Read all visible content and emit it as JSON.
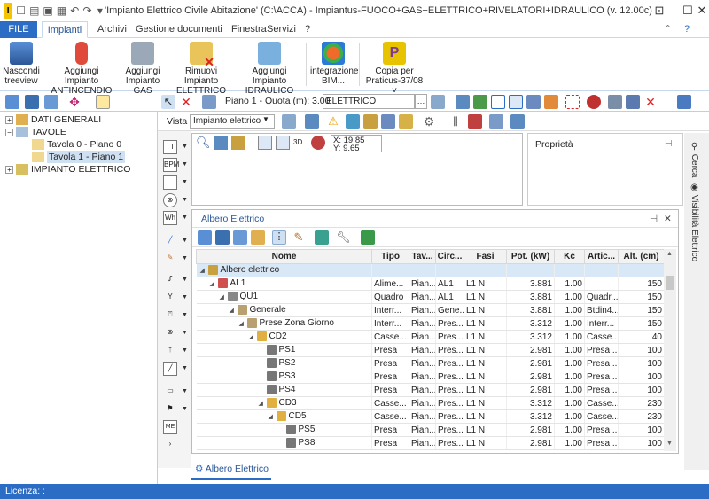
{
  "window": {
    "title": "'Impianto Elettrico Civile Abitazione' (C:\\ACCA) - Impiantus-FUOCO+GAS+ELETTRICO+RIVELATORI+IDRAULICO (v. 12.00c)"
  },
  "menu": {
    "file": "FILE",
    "tabs": [
      "Impianti",
      "Archivi",
      "Gestione documenti",
      "Finestra",
      "Servizi",
      "?"
    ]
  },
  "ribbon": [
    {
      "label": "Nascondi treeview"
    },
    {
      "label": "Aggiungi Impianto ANTINCENDIO"
    },
    {
      "label": "Aggiungi Impianto GAS"
    },
    {
      "label": "Rimuovi Impianto ELETTRICO"
    },
    {
      "label": "Aggiungi Impianto IDRAULICO"
    },
    {
      "label": "integrazione BIM..."
    },
    {
      "label": "Copia per Praticus-37/08 ˅"
    }
  ],
  "tree": [
    {
      "label": "DATI GENERALI",
      "expander": "+"
    },
    {
      "label": "TAVOLE",
      "expander": "−"
    },
    {
      "label": "Tavola 0 - Piano 0"
    },
    {
      "label": "Tavola 1 - Piano 1"
    },
    {
      "label": "IMPIANTO ELETTRICO",
      "expander": "+"
    }
  ],
  "toolbar": {
    "piano": "Piano 1 - Quota (m): 3.00",
    "layer": "ELETTRICO"
  },
  "vista": {
    "label": "Vista",
    "value": "Impianto elettrico"
  },
  "coords": {
    "x": "X: 19.85",
    "y": "Y: 9.65"
  },
  "props": {
    "title": "Proprietà",
    "pin": "⊣"
  },
  "side_tabs": [
    "Cerca",
    "Visibilità Elettrico"
  ],
  "albero": {
    "title": "Albero Elettrico",
    "pin": "⊣",
    "close": "✕",
    "bottom_tab": "Albero Elettrico",
    "columns": [
      "Nome",
      "Tipo",
      "Tav...",
      "Circ...",
      "Fasi",
      "Pot. (kW)",
      "Kc",
      "Artic...",
      "Alt. (cm)"
    ],
    "rows": [
      {
        "indent": 0,
        "expander": "◢",
        "name": "Albero elettrico",
        "vals": [
          "",
          "",
          "",
          "",
          "",
          "",
          "",
          ""
        ]
      },
      {
        "indent": 1,
        "expander": "◢",
        "name": "AL1",
        "vals": [
          "Alime...",
          "Pian...",
          "AL1",
          "L1 N",
          "3.881",
          "1.00",
          "",
          "150"
        ]
      },
      {
        "indent": 2,
        "expander": "◢",
        "name": "QU1",
        "vals": [
          "Quadro",
          "Pian...",
          "AL1",
          "L1 N",
          "3.881",
          "1.00",
          "Quadr...",
          "150"
        ]
      },
      {
        "indent": 3,
        "expander": "◢",
        "name": "Generale",
        "vals": [
          "Interr...",
          "Pian...",
          "Gene...",
          "L1 N",
          "3.881",
          "1.00",
          "Btdin4...",
          "150"
        ]
      },
      {
        "indent": 4,
        "expander": "◢",
        "name": "Prese Zona Giorno",
        "vals": [
          "Interr...",
          "Pian...",
          "Pres...",
          "L1 N",
          "3.312",
          "1.00",
          "Interr...",
          "150"
        ]
      },
      {
        "indent": 5,
        "expander": "◢",
        "name": "CD2",
        "vals": [
          "Casse...",
          "Pian...",
          "Pres...",
          "L1 N",
          "3.312",
          "1.00",
          "Casse...",
          "40"
        ]
      },
      {
        "indent": 6,
        "expander": "",
        "name": "PS1",
        "vals": [
          "Presa",
          "Pian...",
          "Pres...",
          "L1 N",
          "2.981",
          "1.00",
          "Presa ...",
          "100"
        ]
      },
      {
        "indent": 6,
        "expander": "",
        "name": "PS2",
        "vals": [
          "Presa",
          "Pian...",
          "Pres...",
          "L1 N",
          "2.981",
          "1.00",
          "Presa ...",
          "100"
        ]
      },
      {
        "indent": 6,
        "expander": "",
        "name": "PS3",
        "vals": [
          "Presa",
          "Pian...",
          "Pres...",
          "L1 N",
          "2.981",
          "1.00",
          "Presa ...",
          "100"
        ]
      },
      {
        "indent": 6,
        "expander": "",
        "name": "PS4",
        "vals": [
          "Presa",
          "Pian...",
          "Pres...",
          "L1 N",
          "2.981",
          "1.00",
          "Presa ...",
          "100"
        ]
      },
      {
        "indent": 6,
        "expander": "◢",
        "name": "CD3",
        "vals": [
          "Casse...",
          "Pian...",
          "Pres...",
          "L1 N",
          "3.312",
          "1.00",
          "Casse...",
          "230"
        ]
      },
      {
        "indent": 7,
        "expander": "◢",
        "name": "CD5",
        "vals": [
          "Casse...",
          "Pian...",
          "Pres...",
          "L1 N",
          "3.312",
          "1.00",
          "Casse...",
          "230"
        ]
      },
      {
        "indent": 8,
        "expander": "",
        "name": "PS5",
        "vals": [
          "Presa",
          "Pian...",
          "Pres...",
          "L1 N",
          "2.981",
          "1.00",
          "Presa ...",
          "100"
        ]
      },
      {
        "indent": 8,
        "expander": "",
        "name": "PS8",
        "vals": [
          "Presa",
          "Pian...",
          "Pres...",
          "L1 N",
          "2.981",
          "1.00",
          "Presa ...",
          "100"
        ]
      }
    ]
  },
  "status": {
    "text": "Licenza: :"
  },
  "colors": {
    "accent": "#2b6cc4",
    "selected": "#d9e8f7"
  }
}
